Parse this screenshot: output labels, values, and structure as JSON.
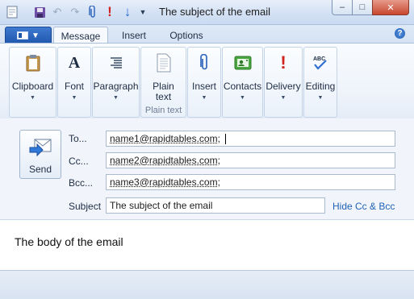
{
  "window": {
    "title": "The subject of the email",
    "buttons": {
      "minimize": "–",
      "maximize": "□",
      "close": "✕"
    }
  },
  "quick_access": [
    "save-icon",
    "undo-icon",
    "redo-icon",
    "attach-icon",
    "importance-high-icon",
    "importance-low-icon",
    "customize-dropdown-icon"
  ],
  "tabs": [
    {
      "label": "Message",
      "active": true
    },
    {
      "label": "Insert",
      "active": false
    },
    {
      "label": "Options",
      "active": false
    }
  ],
  "ribbon": {
    "groups": {
      "clipboard": "Clipboard",
      "font": "Font",
      "paragraph": "Paragraph",
      "plain_text_button": "Plain text",
      "plain_text_caption": "Plain text",
      "insert": "Insert",
      "contacts": "Contacts",
      "delivery": "Delivery",
      "editing": "Editing"
    }
  },
  "header": {
    "send_label": "Send",
    "to_label": "To...",
    "to_value": "name1@rapidtables.com;",
    "cc_label": "Cc...",
    "cc_value": "name2@rapidtables.com;",
    "bcc_label": "Bcc...",
    "bcc_value": "name3@rapidtables.com;",
    "subject_label": "Subject",
    "subject_value": "The subject of the email",
    "hide_cc_bcc": "Hide Cc & Bcc"
  },
  "body": {
    "text": "The body of the email"
  },
  "colors": {
    "accent": "#1f57ad",
    "link": "#1e62b5",
    "ribbon_border": "#a9bfdc"
  }
}
